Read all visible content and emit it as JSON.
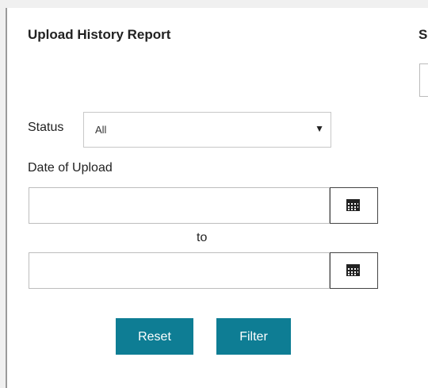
{
  "report": {
    "title": "Upload History Report",
    "cut_off_letter": "S"
  },
  "status": {
    "label": "Status",
    "selected": "All"
  },
  "date_of_upload": {
    "label": "Date of Upload",
    "from_value": "",
    "to_value": "",
    "separator": "to",
    "icon": "calendar-icon"
  },
  "actions": {
    "reset_label": "Reset",
    "filter_label": "Filter"
  },
  "colors": {
    "button_bg": "#0e7d94",
    "button_text": "#ffffff"
  }
}
